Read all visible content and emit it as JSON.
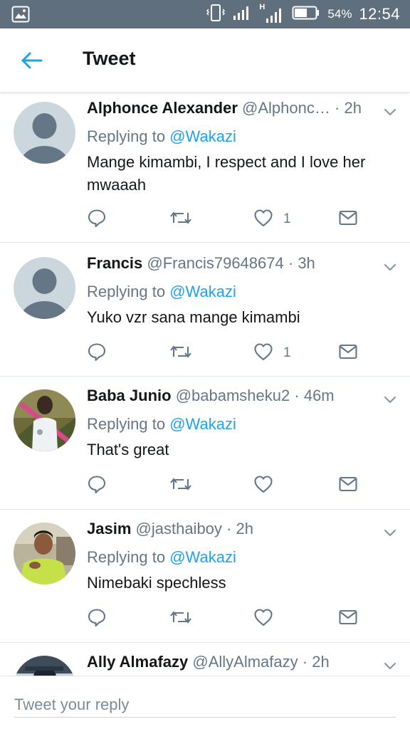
{
  "status_bar": {
    "network_h": "H",
    "battery_pct": "54%",
    "time": "12:54"
  },
  "header": {
    "title": "Tweet",
    "back_icon": "arrow-left-icon"
  },
  "colors": {
    "accent": "#1da1f2",
    "status_bar": "#5f6f7e",
    "muted_text": "#657786",
    "divider": "#e1e8ed"
  },
  "tweets": [
    {
      "name": "Alphonce Alexander",
      "handle": "@Alphonc…",
      "dot": "·",
      "time": "2h",
      "replying_prefix": "Replying to",
      "replying_to": "@Wakazi",
      "text": "Mange kimambi, I respect and I love her mwaaah",
      "like_count": "1",
      "avatar": "default-avatar"
    },
    {
      "name": "Francis",
      "handle": "@Francis79648674",
      "dot": "·",
      "time": "3h",
      "replying_prefix": "Replying to",
      "replying_to": "@Wakazi",
      "text": "Yuko vzr sana mange kimambi",
      "like_count": "1",
      "avatar": "default-avatar"
    },
    {
      "name": "Baba Junio",
      "handle": "@babamsheku2",
      "dot": "·",
      "time": "46m",
      "replying_prefix": "Replying to",
      "replying_to": "@Wakazi",
      "text": "That's great",
      "like_count": "",
      "avatar": "photo-avatar"
    },
    {
      "name": "Jasim",
      "handle": "@jasthaiboy",
      "dot": "·",
      "time": "2h",
      "replying_prefix": "Replying to",
      "replying_to": "@Wakazi",
      "text": "Nimebaki spechless",
      "like_count": "",
      "avatar": "photo-avatar"
    },
    {
      "name": "Ally Almafazy",
      "handle": "@AllyAlmafazy",
      "dot": "·",
      "time": "2h",
      "avatar": "photo-avatar"
    }
  ],
  "reply_bar": {
    "placeholder": "Tweet your reply",
    "value": ""
  }
}
